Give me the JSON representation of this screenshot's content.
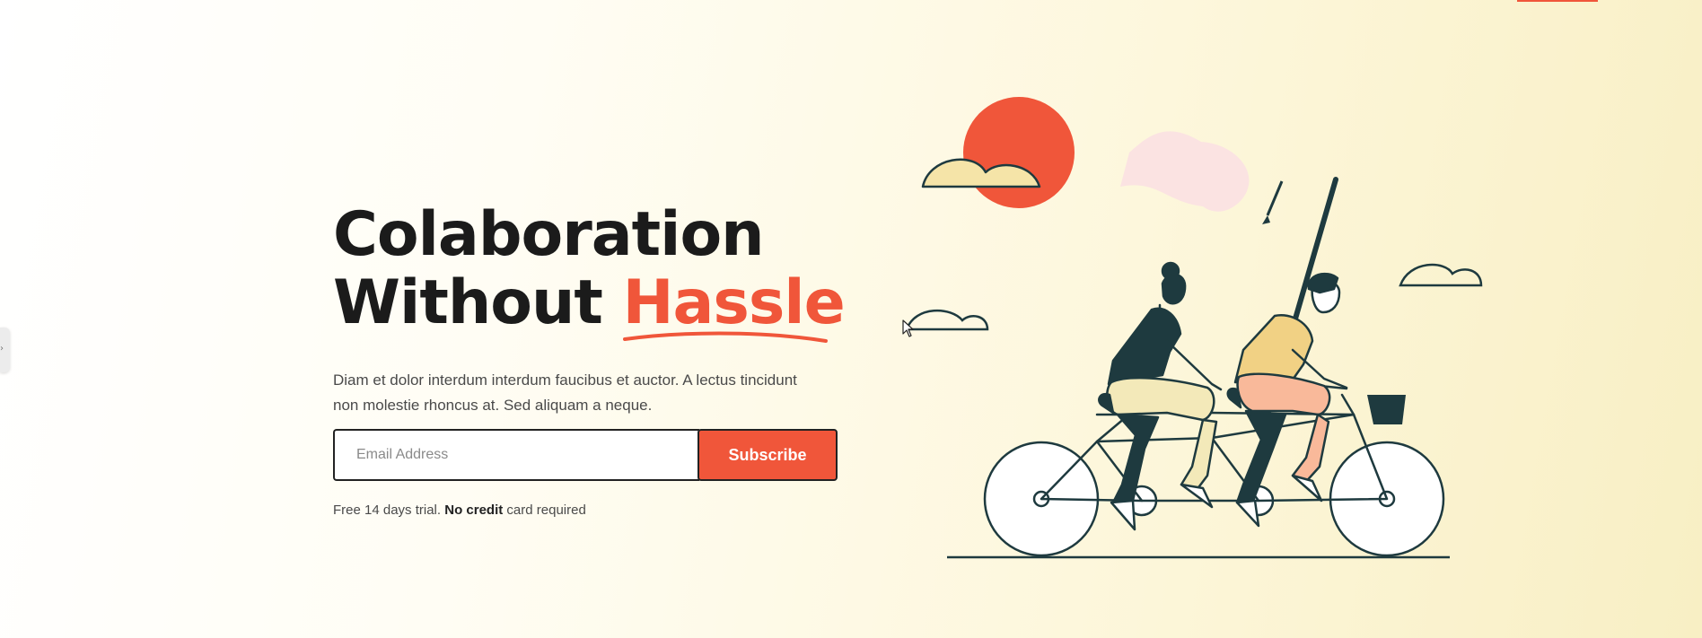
{
  "hero": {
    "headline_line1": "Colaboration",
    "headline_line2_prefix": "Without",
    "headline_accent": "Hassle",
    "description": "Diam et dolor interdum interdum faucibus et auctor. A lectus tincidunt non molestie rhoncus at. Sed aliquam a neque.",
    "email_placeholder": "Email Address",
    "email_value": "",
    "subscribe_label": "Subscribe",
    "trial_prefix": "Free 14 days trial.",
    "trial_bold": "No credit",
    "trial_suffix": "card required"
  },
  "icons": {
    "side_tab": "chevron-right-icon",
    "cursor": "mouse-pointer-icon"
  },
  "illustration": {
    "subject": "two people riding a tandem bicycle holding a flag, with sun and clouds"
  },
  "colors": {
    "accent": "#f0563a",
    "text_dark": "#1b1b1b",
    "text_body": "#4a4a4a",
    "line_art": "#1e3a3f",
    "cloud_fill": "#f5e4a8",
    "flag_fill": "#fbe3e2",
    "shirt_yellow": "#f1d184",
    "pants_peach": "#f9b99a",
    "pants_cream": "#f3e9b9"
  }
}
